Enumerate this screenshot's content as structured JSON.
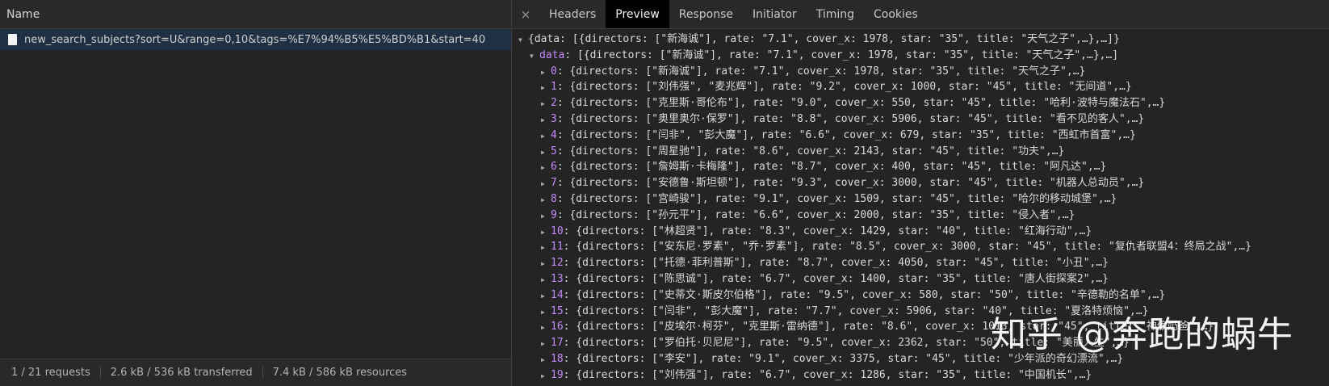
{
  "network": {
    "column_header": "Name",
    "request_name": "new_search_subjects?sort=U&range=0,10&tags=%E7%94%B5%E5%BD%B1&start=40",
    "footer": [
      "1 / 21 requests",
      "2.6 kB / 536 kB transferred",
      "7.4 kB / 586 kB resources"
    ]
  },
  "panel": {
    "close_glyph": "×",
    "tabs": [
      "Headers",
      "Preview",
      "Response",
      "Initiator",
      "Timing",
      "Cookies"
    ],
    "active_tab": "Preview"
  },
  "preview": {
    "root_line": "{data: [{directors: [\"新海诚\"], rate: \"7.1\", cover_x: 1978, star: \"35\", title: \"天气之子\",…},…]}",
    "data_key": "data",
    "data_line": ": [{directors: [\"新海诚\"], rate: \"7.1\", cover_x: 1978, star: \"35\", title: \"天气之子\",…},…]",
    "items": [
      {
        "idx": "0",
        "text": ": {directors: [\"新海诚\"], rate: \"7.1\", cover_x: 1978, star: \"35\", title: \"天气之子\",…}"
      },
      {
        "idx": "1",
        "text": ": {directors: [\"刘伟强\", \"麦兆辉\"], rate: \"9.2\", cover_x: 1000, star: \"45\", title: \"无间道\",…}"
      },
      {
        "idx": "2",
        "text": ": {directors: [\"克里斯·哥伦布\"], rate: \"9.0\", cover_x: 550, star: \"45\", title: \"哈利·波特与魔法石\",…}"
      },
      {
        "idx": "3",
        "text": ": {directors: [\"奥里奥尔·保罗\"], rate: \"8.8\", cover_x: 5906, star: \"45\", title: \"看不见的客人\",…}"
      },
      {
        "idx": "4",
        "text": ": {directors: [\"闫非\", \"彭大魔\"], rate: \"6.6\", cover_x: 679, star: \"35\", title: \"西虹市首富\",…}"
      },
      {
        "idx": "5",
        "text": ": {directors: [\"周星驰\"], rate: \"8.6\", cover_x: 2143, star: \"45\", title: \"功夫\",…}"
      },
      {
        "idx": "6",
        "text": ": {directors: [\"詹姆斯·卡梅隆\"], rate: \"8.7\", cover_x: 400, star: \"45\", title: \"阿凡达\",…}"
      },
      {
        "idx": "7",
        "text": ": {directors: [\"安德鲁·斯坦顿\"], rate: \"9.3\", cover_x: 3000, star: \"45\", title: \"机器人总动员\",…}"
      },
      {
        "idx": "8",
        "text": ": {directors: [\"宫崎骏\"], rate: \"9.1\", cover_x: 1509, star: \"45\", title: \"哈尔的移动城堡\",…}"
      },
      {
        "idx": "9",
        "text": ": {directors: [\"孙元平\"], rate: \"6.6\", cover_x: 2000, star: \"35\", title: \"侵入者\",…}"
      },
      {
        "idx": "10",
        "text": ": {directors: [\"林超贤\"], rate: \"8.3\", cover_x: 1429, star: \"40\", title: \"红海行动\",…}"
      },
      {
        "idx": "11",
        "text": ": {directors: [\"安东尼·罗素\", \"乔·罗素\"], rate: \"8.5\", cover_x: 3000, star: \"45\", title: \"复仇者联盟4：终局之战\",…}"
      },
      {
        "idx": "12",
        "text": ": {directors: [\"托德·菲利普斯\"], rate: \"8.7\", cover_x: 4050, star: \"45\", title: \"小丑\",…}"
      },
      {
        "idx": "13",
        "text": ": {directors: [\"陈思诚\"], rate: \"6.7\", cover_x: 1400, star: \"35\", title: \"唐人街探案2\",…}"
      },
      {
        "idx": "14",
        "text": ": {directors: [\"史蒂文·斯皮尔伯格\"], rate: \"9.5\", cover_x: 580, star: \"50\", title: \"辛德勒的名单\",…}"
      },
      {
        "idx": "15",
        "text": ": {directors: [\"闫非\", \"彭大魔\"], rate: \"7.7\", cover_x: 5906, star: \"40\", title: \"夏洛特烦恼\",…}"
      },
      {
        "idx": "16",
        "text": ": {directors: [\"皮埃尔·柯芬\", \"克里斯·雷纳德\"], rate: \"8.6\", cover_x: 1013, star: \"45\", title: \"神偷奶爸\",…}"
      },
      {
        "idx": "17",
        "text": ": {directors: [\"罗伯托·贝尼尼\"], rate: \"9.5\", cover_x: 2362, star: \"50\", title: \"美丽人生\",…}"
      },
      {
        "idx": "18",
        "text": ": {directors: [\"李安\"], rate: \"9.1\", cover_x: 3375, star: \"45\", title: \"少年派的奇幻漂流\",…}"
      },
      {
        "idx": "19",
        "text": ": {directors: [\"刘伟强\"], rate: \"6.7\", cover_x: 1286, star: \"35\", title: \"中国机长\",…}"
      }
    ]
  },
  "watermark": "知乎 @奔跑的蜗牛"
}
